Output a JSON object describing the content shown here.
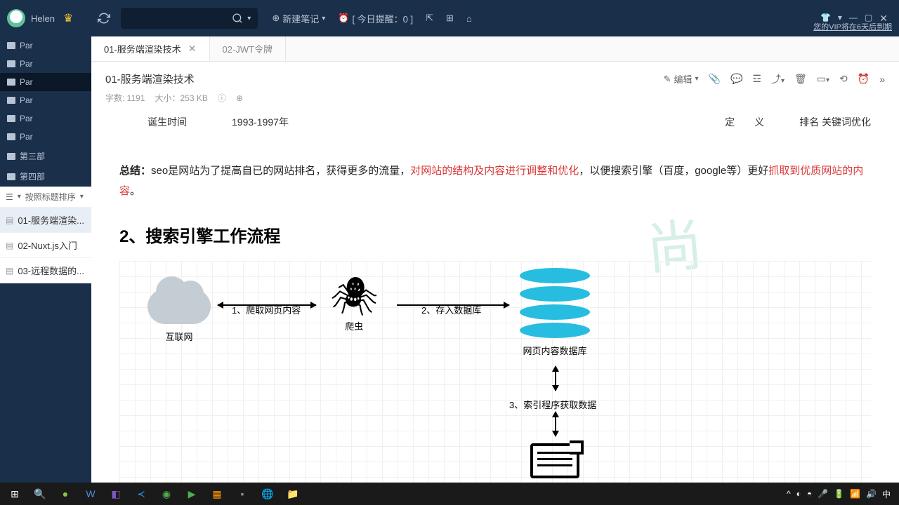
{
  "user": {
    "name": "Helen"
  },
  "vip_notice": "您的VIP将在6天后到期",
  "toolbar": {
    "new_note": "新建笔记",
    "today_reminder": "[ 今日提醒：0 ]"
  },
  "sidebar": {
    "folders": [
      "Par",
      "Par",
      "Par",
      "Par",
      "Par",
      "Par"
    ],
    "sections": [
      "第三部",
      "第四部"
    ],
    "sort_label": "按照标题排序",
    "notes": [
      "01-服务端渲染...",
      "02-Nuxt.js入门",
      "03-远程数据的..."
    ]
  },
  "tabs": [
    {
      "label": "01-服务端渲染技术",
      "active": true
    },
    {
      "label": "02-JWT令牌",
      "active": false
    }
  ],
  "doc": {
    "title": "01-服务端渲染技术",
    "edit_label": "编辑",
    "word_count_label": "字数: 1191",
    "size_label": "大小：253 KB",
    "row_birth_label": "诞生时间",
    "row_birth_value": "1993-1997年",
    "row_def_label": "定　　义",
    "row_def_value": "排名 关键词优化",
    "summary_prefix": "总结：",
    "summary_1": "seo是网站为了提高自已的网站排名，获得更多的流量，",
    "summary_red1": "对网站的结构及内容进行调整和优化",
    "summary_2": "，以便搜索引擎（百度，google等）更好",
    "summary_red2": "抓取到优质网站的内容",
    "summary_3": "。",
    "heading2": "2、搜索引擎工作流程",
    "watermark": "尚"
  },
  "diagram": {
    "internet": "互联网",
    "spider": "爬虫",
    "db": "网页内容数据库",
    "arrow1": "1、爬取网页内容",
    "arrow2": "2、存入数据库",
    "arrow3": "3、索引程序获取数据"
  },
  "tray": {
    "ime": "中"
  }
}
